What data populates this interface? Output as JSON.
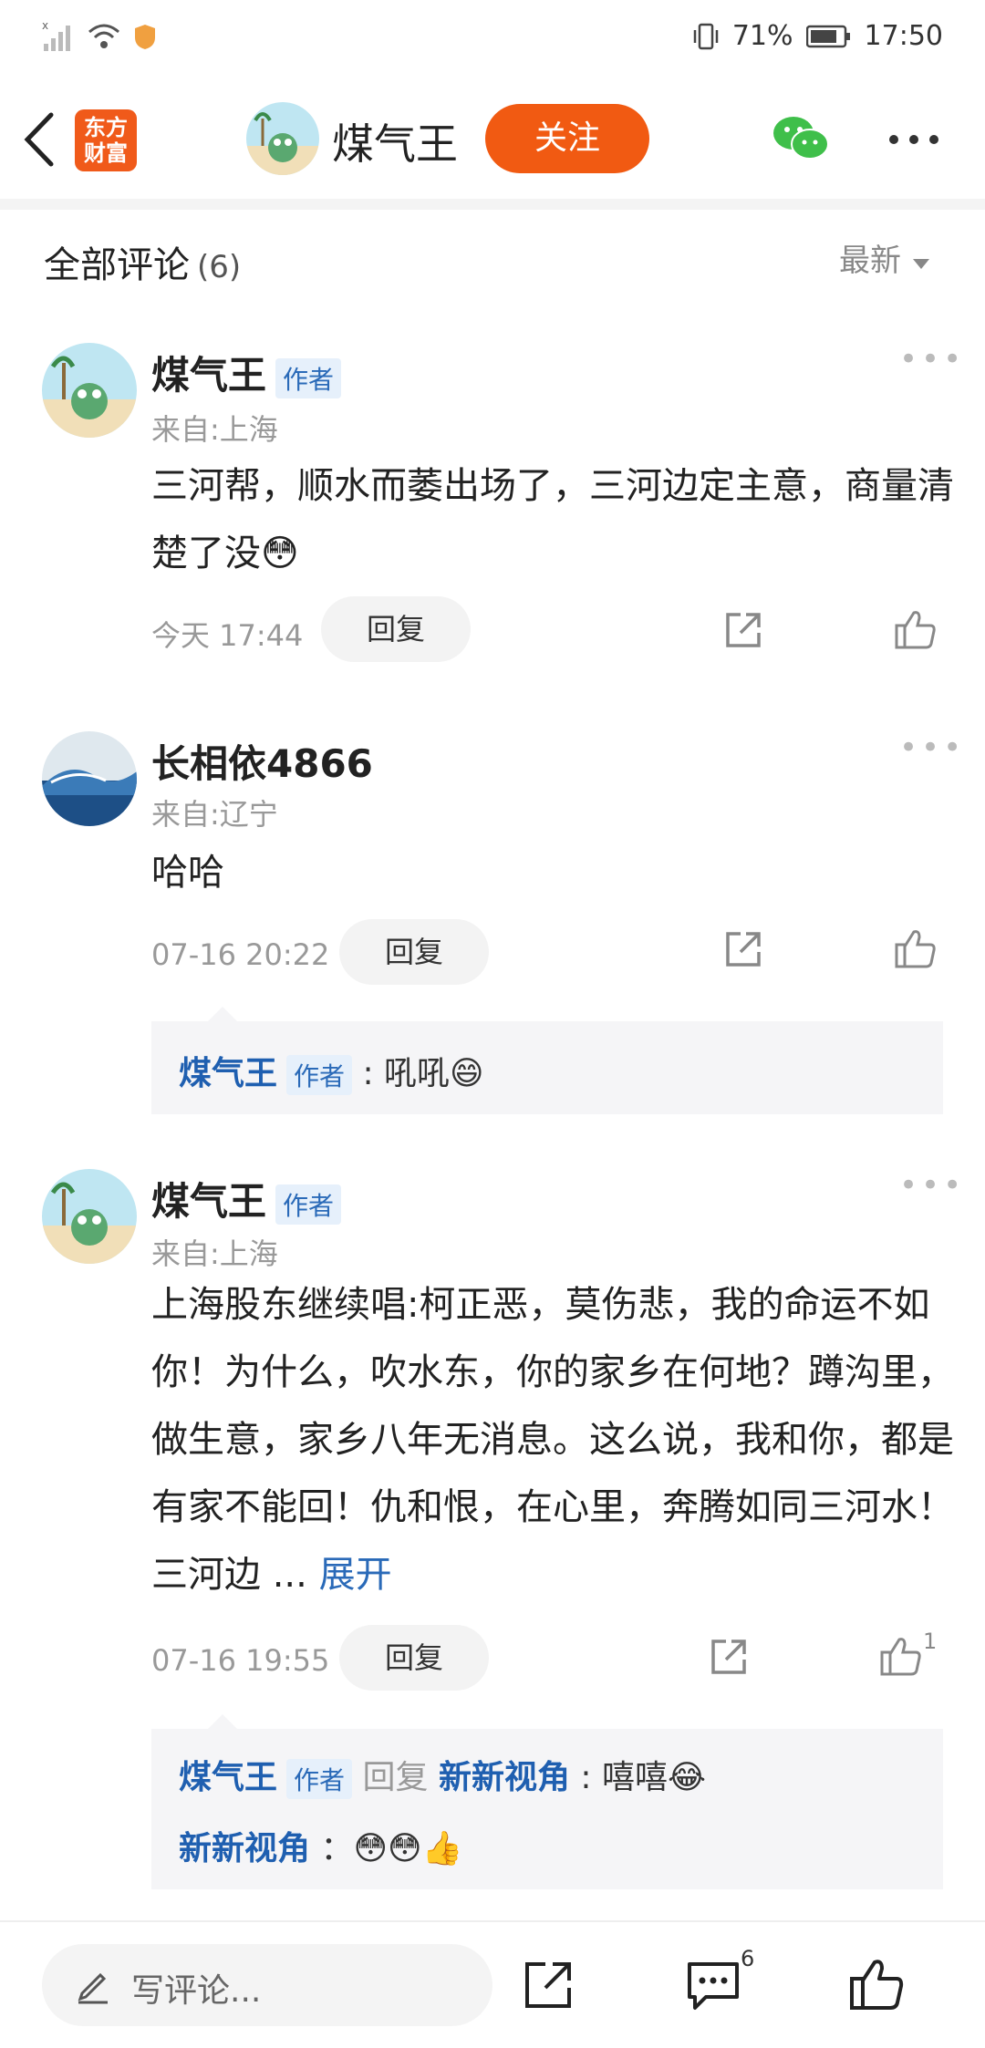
{
  "status": {
    "battery": "71%",
    "time": "17:50"
  },
  "header": {
    "logo_line1": "东方",
    "logo_line2": "财富",
    "title": "煤气王",
    "follow": "关注"
  },
  "section": {
    "title": "全部评论",
    "count": "(6)",
    "sort": "最新"
  },
  "comments": [
    {
      "name": "煤气王",
      "tag": "作者",
      "location": "来自:上海",
      "text": "三河帮，顺水而萎出场了，三河边定主意，商量清楚了没😳",
      "time": "今天 17:44",
      "reply": "回复"
    },
    {
      "name": "长相依4866",
      "location": "来自:辽宁",
      "text": "哈哈",
      "time": "07-16 20:22",
      "reply": "回复",
      "replies": [
        {
          "name": "煤气王",
          "tag": "作者",
          "text": ": 吼吼😄"
        }
      ]
    },
    {
      "name": "煤气王",
      "tag": "作者",
      "location": "来自:上海",
      "text": "上海股东继续唱:柯正恶，莫伤悲，我的命运不如你！为什么，吹水东，你的家乡在何地？蹲沟里，做生意，家乡八年无消息。这么说，我和你，都是有家不能回！仇和恨，在心里，奔腾如同三河水！三河边 ...",
      "expand": "展开",
      "time": "07-16 19:55",
      "reply": "回复",
      "likes": "1",
      "replies": [
        {
          "name": "煤气王",
          "tag": "作者",
          "mid": "回复",
          "target": "新新视角",
          "text": ": 嘻嘻😂"
        },
        {
          "name": "新新视角",
          "text": "：😳😳👍"
        }
      ]
    }
  ],
  "bottom": {
    "placeholder": "写评论...",
    "comment_count": "6"
  },
  "colors": {
    "accent": "#f15a12",
    "link": "#1f5fb0"
  }
}
